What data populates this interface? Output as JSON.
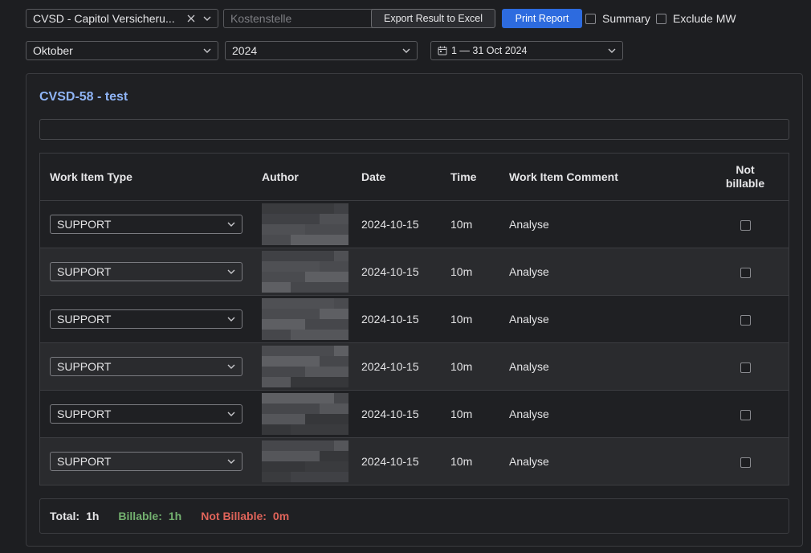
{
  "filters": {
    "project_select": "CVSD - Capitol Versicheru...",
    "cost_center_placeholder": "Kostenstelle",
    "export_button": "Export Result to Excel",
    "print_button": "Print Report",
    "summary_label": "Summary",
    "exclude_label": "Exclude MW",
    "month_select": "Oktober",
    "year_select": "2024",
    "date_range": "1 — 31 Oct 2024"
  },
  "issue": {
    "title": "CVSD-58 - test"
  },
  "table": {
    "headers": {
      "type": "Work Item Type",
      "author": "Author",
      "date": "Date",
      "time": "Time",
      "comment": "Work Item Comment",
      "not_billable_1": "Not",
      "not_billable_2": "billable"
    },
    "rows": [
      {
        "type": "SUPPORT",
        "date": "2024-10-15",
        "time": "10m",
        "comment": "Analyse"
      },
      {
        "type": "SUPPORT",
        "date": "2024-10-15",
        "time": "10m",
        "comment": "Analyse"
      },
      {
        "type": "SUPPORT",
        "date": "2024-10-15",
        "time": "10m",
        "comment": "Analyse"
      },
      {
        "type": "SUPPORT",
        "date": "2024-10-15",
        "time": "10m",
        "comment": "Analyse"
      },
      {
        "type": "SUPPORT",
        "date": "2024-10-15",
        "time": "10m",
        "comment": "Analyse"
      },
      {
        "type": "SUPPORT",
        "date": "2024-10-15",
        "time": "10m",
        "comment": "Analyse"
      }
    ]
  },
  "totals": {
    "total_label": "Total:",
    "total_value": "1h",
    "billable_label": "Billable:",
    "billable_value": "1h",
    "not_billable_label": "Not Billable:",
    "not_billable_value": "0m"
  },
  "colors": {
    "accent": "#2d6bdf",
    "title_link": "#8fb4f5",
    "billable": "#73b06f",
    "not_billable": "#e0645a"
  },
  "icons": {
    "clear": "close-icon",
    "dropdown": "chevron-down-icon",
    "calendar": "calendar-icon"
  }
}
